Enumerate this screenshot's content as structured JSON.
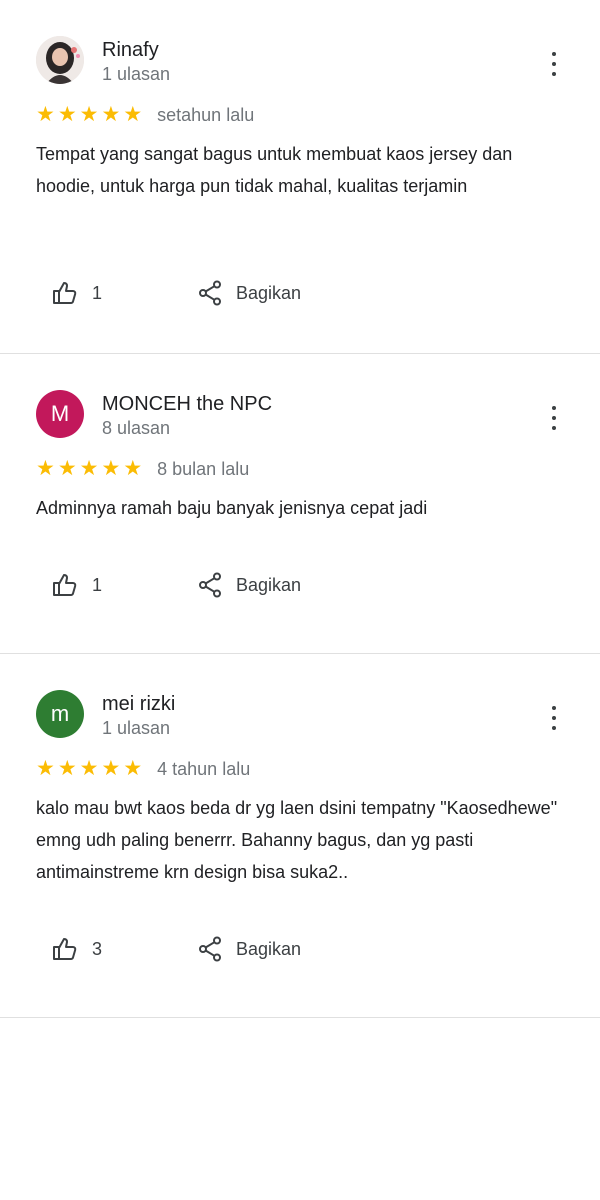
{
  "reviews": [
    {
      "name": "Rinafy",
      "review_count": "1 ulasan",
      "rating": 5,
      "time": "setahun lalu",
      "text": "Tempat yang sangat bagus untuk membuat kaos jersey dan hoodie, untuk harga pun tidak mahal, kualitas terjamin",
      "likes": "1",
      "share_label": "Bagikan",
      "avatar": {
        "type": "photo"
      }
    },
    {
      "name": "MONCEH the NPC",
      "review_count": "8 ulasan",
      "rating": 5,
      "time": "8 bulan lalu",
      "text": "Adminnya ramah baju banyak jenisnya cepat jadi",
      "likes": "1",
      "share_label": "Bagikan",
      "avatar": {
        "type": "letter",
        "letter": "M",
        "color": "#c2185b"
      }
    },
    {
      "name": "mei rizki",
      "review_count": "1 ulasan",
      "rating": 5,
      "time": "4 tahun lalu",
      "text": "kalo mau bwt kaos beda dr yg laen dsini tempatny \"Kaosedhewe\" emng udh paling benerrr. Bahanny bagus, dan yg pasti antimainstreme krn design bisa suka2..",
      "likes": "3",
      "share_label": "Bagikan",
      "avatar": {
        "type": "letter",
        "letter": "m",
        "color": "#2e7d32"
      }
    }
  ],
  "colors": {
    "star": "#fbbc04",
    "secondary_text": "#70757a",
    "divider": "#e0e0e0"
  },
  "icons": {
    "like": "thumb-up-icon",
    "share": "share-icon",
    "more": "more-vert-icon",
    "star": "star-icon"
  }
}
